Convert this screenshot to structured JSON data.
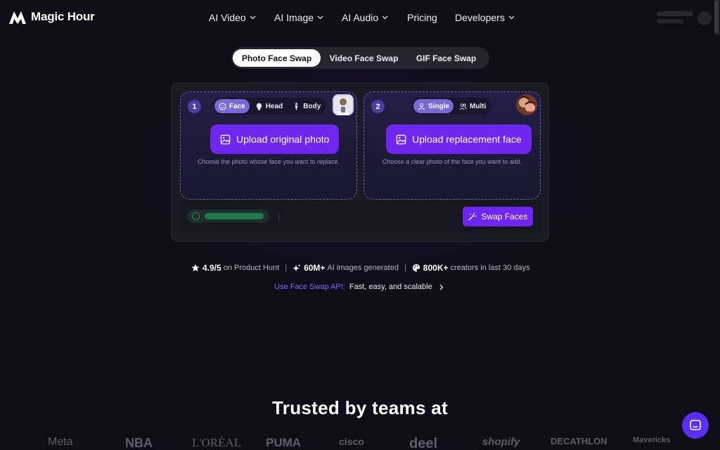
{
  "brand": {
    "name": "Magic Hour"
  },
  "nav": {
    "items": [
      {
        "label": "AI Video",
        "dropdown": true
      },
      {
        "label": "AI Image",
        "dropdown": true
      },
      {
        "label": "AI Audio",
        "dropdown": true
      },
      {
        "label": "Pricing",
        "dropdown": false
      },
      {
        "label": "Developers",
        "dropdown": true
      }
    ]
  },
  "tabs": [
    {
      "label": "Photo Face Swap",
      "active": true
    },
    {
      "label": "Video Face Swap",
      "active": false
    },
    {
      "label": "GIF Face Swap",
      "active": false
    }
  ],
  "panel1": {
    "step": "1",
    "modes": [
      {
        "label": "Face",
        "icon": "smile-icon",
        "selected": true
      },
      {
        "label": "Head",
        "icon": "head-icon",
        "selected": false
      },
      {
        "label": "Body",
        "icon": "body-icon",
        "selected": false
      }
    ],
    "upload_label": "Upload original photo",
    "hint": "Choose the photo whose face you want to replace."
  },
  "panel2": {
    "step": "2",
    "modes": [
      {
        "label": "Single",
        "icon": "user-icon",
        "selected": true
      },
      {
        "label": "Multi",
        "icon": "users-icon",
        "selected": false
      }
    ],
    "upload_label": "Upload replacement face",
    "hint": "Choose a clear photo of the face you want to add."
  },
  "action": {
    "swap_label": "Swap Faces"
  },
  "stats": {
    "rating": "4.9/5",
    "rating_text": "on Product Hunt",
    "images": "60M+",
    "images_text": "AI images generated",
    "creators": "800K+",
    "creators_text": "creators in last 30 days"
  },
  "api": {
    "link": "Use Face Swap API:",
    "text": "Fast, easy, and scalable"
  },
  "trusted": {
    "heading": "Trusted by teams at"
  },
  "logos": [
    "Meta",
    "NBA",
    "L'ORÉAL",
    "PUMA",
    "cisco",
    "deel",
    "shopify",
    "DECATHLON",
    "Mavericks"
  ],
  "colors": {
    "accent": "#6f27f0",
    "background": "#0e0d18",
    "link": "#7b6cff"
  }
}
